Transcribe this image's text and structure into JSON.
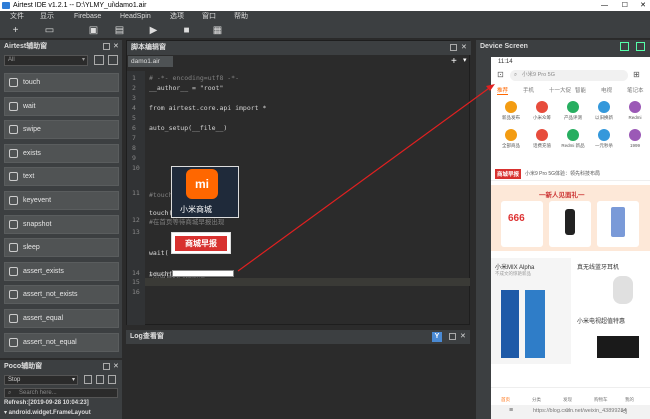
{
  "window": {
    "title": "Airtest IDE v1.2.1 -- D:\\YLMY_ui\\damo1.air"
  },
  "menu": [
    "文件",
    "显示",
    "Firebase",
    "HeadSpin",
    "选项",
    "窗口",
    "帮助"
  ],
  "left_panel": {
    "title": "Airtest辅助窗",
    "filter": "All",
    "buttons": [
      "touch",
      "wait",
      "swipe",
      "exists",
      "text",
      "keyevent",
      "snapshot",
      "sleep",
      "assert_exists",
      "assert_not_exists",
      "assert_equal",
      "assert_not_equal"
    ]
  },
  "poco_panel": {
    "title": "Poco辅助窗",
    "mode": "Stop",
    "search_placeholder": "Search here...",
    "refresh": "Refresh:[2019-09-28 10:04:23]",
    "tree_root": "▾ android.widget.FrameLayout"
  },
  "editor": {
    "title": "脚本编辑窗",
    "tab": "damo1.air",
    "lines": [
      {
        "n": "1",
        "text": "# -*- encoding=utf8 -*-",
        "kind": "comment"
      },
      {
        "n": "2",
        "text": "__author__ = \"root\"",
        "kind": "code"
      },
      {
        "n": "3",
        "text": "",
        "kind": "code"
      },
      {
        "n": "4",
        "text": "from airtest.core.api import *",
        "kind": "code"
      },
      {
        "n": "5",
        "text": "",
        "kind": "code"
      },
      {
        "n": "6",
        "text": "auto_setup(__file__)",
        "kind": "code"
      },
      {
        "n": "7",
        "text": "",
        "kind": "code"
      },
      {
        "n": "8",
        "text": "",
        "kind": "code"
      },
      {
        "n": "9",
        "text": "",
        "kind": "code"
      },
      {
        "n": "10",
        "text": "",
        "kind": "code"
      },
      {
        "n": "11",
        "text": "#touch找APP图标点击",
        "kind": "comment"
      },
      {
        "n": "12",
        "text": "#在首页等待商城早报出现",
        "kind": "comment"
      },
      {
        "n": "13",
        "text": "",
        "kind": "code"
      },
      {
        "n": "14",
        "text": "#点击首页的搜索框",
        "kind": "comment"
      },
      {
        "n": "15",
        "text": "",
        "kind": "code"
      },
      {
        "n": "16",
        "text": "",
        "kind": "code"
      }
    ],
    "touch1": "touch(",
    "wait1": "wait(",
    "touch2": "touch(",
    "thumb1": "小米商城",
    "thumb2": "商城早报"
  },
  "log_panel": {
    "title": "Log查看窗"
  },
  "device_panel": {
    "title": "Device Screen",
    "status_time": "11:14",
    "search_text": "小米9 Pro 5G",
    "tabs": [
      "推荐",
      "手机",
      "十一大促",
      "智能",
      "电视",
      "笔记本"
    ],
    "icons": [
      "新品发布",
      "小米众筹",
      "产品评测",
      "以旧换新",
      "Redmi"
    ],
    "icons2": [
      "全部商品",
      "话费充值",
      "Redmi 新品",
      "一元秒杀",
      "1999"
    ],
    "promo": "商城早报",
    "promo_text": "小米9 Pro 5G体验：领先科技布局",
    "banner": "一新人见面礼一",
    "coupon": "666",
    "mix_title": "小米MIX Alpha",
    "mix_sub": "不成文的惊艳新品",
    "speaker_title": "真无线蓝牙耳机",
    "tv_title": "小米电视超值特惠",
    "bottom_nav": [
      "首页",
      "分类",
      "发现",
      "购物车",
      "我的"
    ],
    "watermark": "https://blog.csdn.net/weixin_43899284"
  }
}
